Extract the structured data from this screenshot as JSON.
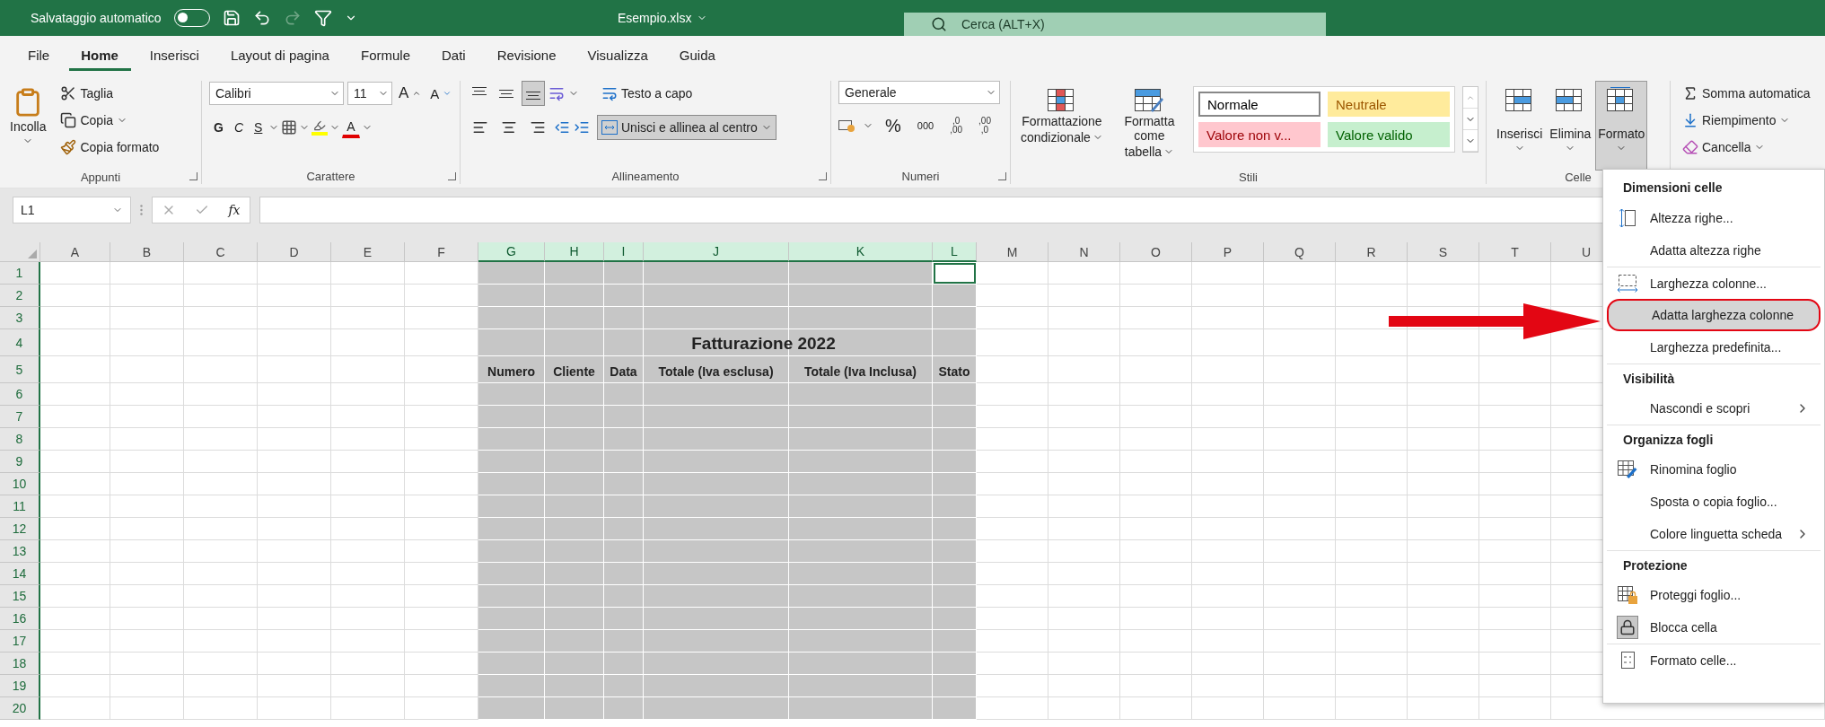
{
  "title_bar": {
    "autosave_label": "Salvataggio automatico",
    "autosave_on": false,
    "redo_disabled": true,
    "file_name": "Esempio.xlsx",
    "search_placeholder": "Cerca (ALT+X)"
  },
  "menu_tabs": [
    {
      "label": "File",
      "selected": false
    },
    {
      "label": "Home",
      "selected": true
    },
    {
      "label": "Inserisci",
      "selected": false
    },
    {
      "label": "Layout di pagina",
      "selected": false
    },
    {
      "label": "Formule",
      "selected": false
    },
    {
      "label": "Dati",
      "selected": false
    },
    {
      "label": "Revisione",
      "selected": false
    },
    {
      "label": "Visualizza",
      "selected": false
    },
    {
      "label": "Guida",
      "selected": false
    }
  ],
  "ribbon": {
    "groups": [
      {
        "kind": "clipboard",
        "label": "Appunti",
        "paste": "Incolla",
        "actions": [
          {
            "label": "Taglia",
            "dropdown": false
          },
          {
            "label": "Copia",
            "dropdown": true
          },
          {
            "label": "Copia formato",
            "dropdown": false
          }
        ]
      },
      {
        "kind": "font",
        "label": "Carattere",
        "font": "Calibri",
        "size": "11",
        "grow_font": "A",
        "shrink_font": "A",
        "styles": [
          "G",
          "C",
          "S"
        ],
        "font_color_letter": "A"
      },
      {
        "kind": "alignment",
        "label": "Allineamento",
        "vertical": [
          {
            "selected": false
          },
          {
            "selected": false
          },
          {
            "selected": true
          }
        ],
        "horizontal": [
          {
            "selected": false
          },
          {
            "selected": false
          },
          {
            "selected": false
          }
        ],
        "wrap": "Testo a capo",
        "merge": {
          "label": "Unisci e allinea al centro",
          "selected": true
        }
      },
      {
        "kind": "number",
        "label": "Numeri",
        "format": "Generale",
        "percent": "%",
        "thousands": "000",
        "decimals": [
          {
            "top": ",0",
            "bottom": ",00"
          },
          {
            "top": ",00",
            "bottom": ",0"
          }
        ]
      },
      {
        "kind": "styles",
        "label": "Stili",
        "buttons": [
          {
            "lines": [
              "Formattazione",
              "condizionale"
            ]
          },
          {
            "lines": [
              "Formatta come",
              "tabella"
            ]
          }
        ],
        "gallery": [
          {
            "label": "Normale",
            "color": "#ffffff",
            "selected": true
          },
          {
            "label": "Neutrale",
            "color": "#ffeb9c",
            "selected": false
          },
          {
            "label": "Valore non v...",
            "color": "#ffc7ce",
            "selected": false
          },
          {
            "label": "Valore valido",
            "color": "#c6efce",
            "selected": false
          }
        ]
      },
      {
        "kind": "cells",
        "label": "Celle",
        "buttons": [
          {
            "label": "Inserisci",
            "selected": false
          },
          {
            "label": "Elimina",
            "selected": false
          },
          {
            "label": "Formato",
            "selected": true
          }
        ]
      },
      {
        "kind": "editing",
        "actions": [
          {
            "label": "Somma automatica",
            "dropdown": false
          },
          {
            "label": "Riempimento",
            "dropdown": true
          },
          {
            "label": "Cancella",
            "dropdown": true
          }
        ]
      }
    ]
  },
  "formula_bar": {
    "name_box": "L1",
    "function_label": "fx"
  },
  "sheet": {
    "columns": [
      {
        "label": "A",
        "selected": false
      },
      {
        "label": "B",
        "selected": false
      },
      {
        "label": "C",
        "selected": false
      },
      {
        "label": "D",
        "selected": false
      },
      {
        "label": "E",
        "selected": false
      },
      {
        "label": "F",
        "selected": false
      },
      {
        "label": "G",
        "selected": true,
        "header": "Numero"
      },
      {
        "label": "H",
        "selected": true,
        "header": "Cliente"
      },
      {
        "label": "I",
        "selected": true,
        "header": "Data"
      },
      {
        "label": "J",
        "selected": true,
        "header": "Totale (Iva esclusa)"
      },
      {
        "label": "K",
        "selected": true,
        "header": "Totale (Iva Inclusa)"
      },
      {
        "label": "L",
        "selected": true,
        "header": "Stato",
        "active": true
      },
      {
        "label": "M",
        "selected": false
      },
      {
        "label": "N",
        "selected": false
      },
      {
        "label": "O",
        "selected": false
      },
      {
        "label": "P",
        "selected": false
      },
      {
        "label": "Q",
        "selected": false
      },
      {
        "label": "R",
        "selected": false
      },
      {
        "label": "S",
        "selected": false
      },
      {
        "label": "T",
        "selected": false
      },
      {
        "label": "U",
        "selected": false
      }
    ],
    "rows": [
      {
        "label": "1",
        "active": true
      },
      {
        "label": "2"
      },
      {
        "label": "3"
      },
      {
        "label": "4",
        "kind": "title"
      },
      {
        "label": "5",
        "kind": "header"
      },
      {
        "label": "6"
      },
      {
        "label": "7"
      },
      {
        "label": "8"
      },
      {
        "label": "9"
      },
      {
        "label": "10"
      },
      {
        "label": "11"
      },
      {
        "label": "12"
      },
      {
        "label": "13"
      },
      {
        "label": "14"
      },
      {
        "label": "15"
      },
      {
        "label": "16"
      },
      {
        "label": "17"
      },
      {
        "label": "18"
      },
      {
        "label": "19"
      },
      {
        "label": "20"
      }
    ],
    "title": "Fatturazione 2022"
  },
  "format_menu": {
    "sections": [
      {
        "heading": "Dimensioni celle",
        "items": [
          {
            "label": "Altezza righe...",
            "selected": false
          },
          {
            "label": "Adatta altezza righe",
            "selected": false
          },
          {
            "label": "Larghezza colonne...",
            "selected": false,
            "divider": true
          },
          {
            "label": "Adatta larghezza colonne",
            "selected": true
          },
          {
            "label": "Larghezza predefinita...",
            "selected": false
          }
        ]
      },
      {
        "heading": "Visibilità",
        "items": [
          {
            "label": "Nascondi e scopri",
            "selected": false,
            "submenu": true
          }
        ]
      },
      {
        "heading": "Organizza fogli",
        "items": [
          {
            "label": "Rinomina foglio",
            "selected": false
          },
          {
            "label": "Sposta o copia foglio...",
            "selected": false
          },
          {
            "label": "Colore linguetta scheda",
            "selected": false,
            "submenu": true
          }
        ]
      },
      {
        "heading": "Protezione",
        "items": [
          {
            "label": "Proteggi foglio...",
            "selected": false
          },
          {
            "label": "Blocca cella",
            "selected": false,
            "checked": true
          },
          {
            "label": "Formato celle...",
            "selected": false,
            "divider": true
          }
        ]
      }
    ]
  },
  "annotation": {
    "arrow": true
  }
}
